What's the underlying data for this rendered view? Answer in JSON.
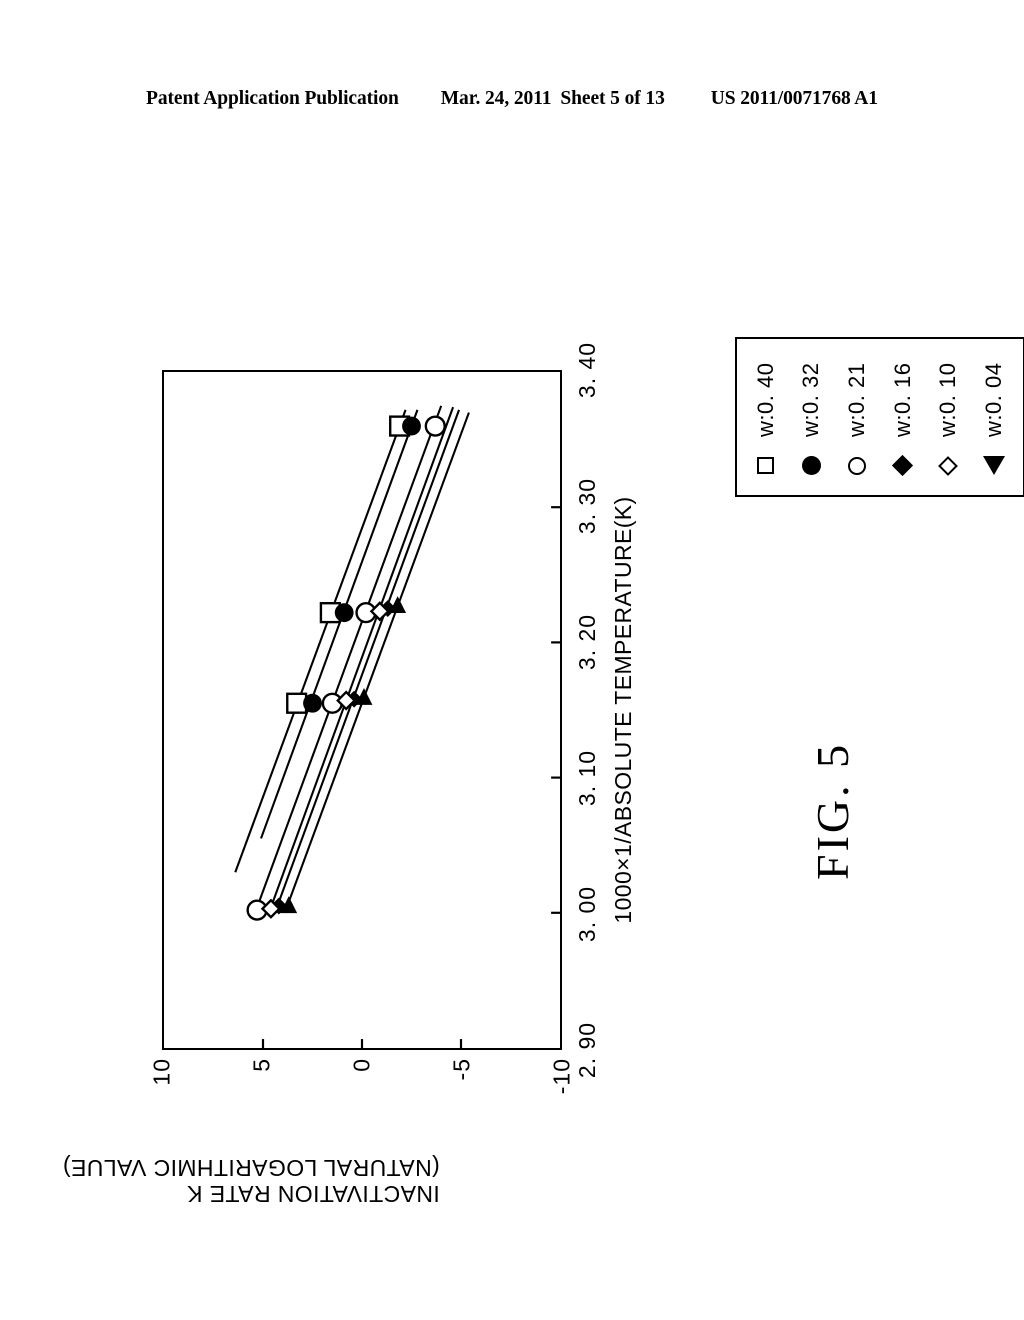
{
  "header": {
    "left": "Patent Application Publication",
    "date": "Mar. 24, 2011",
    "sheet": "Sheet 5 of 13",
    "patent_number": "US 2011/0071768 A1"
  },
  "figure": {
    "title": "FIG. 5"
  },
  "legend": {
    "items": [
      {
        "label": "w:0. 40",
        "marker": "square-open"
      },
      {
        "label": "w:0. 32",
        "marker": "circle-fill"
      },
      {
        "label": "w:0. 21",
        "marker": "circle-open"
      },
      {
        "label": "w:0. 16",
        "marker": "diamond-fill"
      },
      {
        "label": "w:0. 10",
        "marker": "diamond-open"
      },
      {
        "label": "w:0. 04",
        "marker": "triangle-fill"
      }
    ]
  },
  "chart_data": {
    "type": "scatter",
    "title": "FIG. 5",
    "xlabel": "1000×1/ABSOLUTE TEMPERATURE(K)",
    "ylabel": "INACTIVATION RATE K (NATURAL LOGARITHMIC VALUE)",
    "ylabel_lines": [
      "INACTIVATION RATE K",
      "(NATURAL LOGARITHMIC VALUE)"
    ],
    "xlim": [
      2.9,
      3.4
    ],
    "ylim": [
      -10,
      10
    ],
    "xticks": [
      "2. 90",
      "3. 00",
      "3. 10",
      "3. 20",
      "3. 30",
      "3. 40"
    ],
    "xtick_values": [
      2.9,
      3.0,
      3.1,
      3.2,
      3.3,
      3.4
    ],
    "yticks": [
      "10",
      "5",
      "0",
      "-5",
      "-10"
    ],
    "ytick_values": [
      10,
      5,
      0,
      -5,
      -10
    ],
    "grid": false,
    "legend_position": "outside-top-right",
    "series": [
      {
        "name": "w:0. 40",
        "marker": "square-open",
        "points": [
          {
            "x": 3.155,
            "y": 3.3
          },
          {
            "x": 3.222,
            "y": 1.6
          },
          {
            "x": 3.36,
            "y": -1.9
          }
        ],
        "fit_line": {
          "x0": 3.03,
          "y0": 6.4,
          "x1": 3.372,
          "y1": -2.2
        }
      },
      {
        "name": "w:0. 32",
        "marker": "circle-fill",
        "points": [
          {
            "x": 3.155,
            "y": 2.5
          },
          {
            "x": 3.222,
            "y": 0.9
          },
          {
            "x": 3.36,
            "y": -2.5
          }
        ],
        "fit_line": {
          "x0": 3.055,
          "y0": 5.1,
          "x1": 3.372,
          "y1": -2.8
        }
      },
      {
        "name": "w:0. 21",
        "marker": "circle-open",
        "points": [
          {
            "x": 3.002,
            "y": 5.3
          },
          {
            "x": 3.155,
            "y": 1.5
          },
          {
            "x": 3.222,
            "y": -0.2
          },
          {
            "x": 3.36,
            "y": -3.7
          }
        ],
        "fit_line": {
          "x0": 3.0,
          "y0": 5.4,
          "x1": 3.375,
          "y1": -4.0
        }
      },
      {
        "name": "w:0. 16",
        "marker": "diamond-fill",
        "points": [
          {
            "x": 3.005,
            "y": 4.2
          },
          {
            "x": 3.158,
            "y": 0.4
          },
          {
            "x": 3.225,
            "y": -1.3
          }
        ],
        "fit_line": {
          "x0": 3.0,
          "y0": 4.4,
          "x1": 3.372,
          "y1": -4.9
        }
      },
      {
        "name": "w:0. 10",
        "marker": "diamond-open",
        "points": [
          {
            "x": 3.003,
            "y": 4.6
          },
          {
            "x": 3.157,
            "y": 0.8
          },
          {
            "x": 3.223,
            "y": -0.9
          }
        ],
        "fit_line": {
          "x0": 3.0,
          "y0": 4.7,
          "x1": 3.374,
          "y1": -4.6
        }
      },
      {
        "name": "w:0. 04",
        "marker": "triangle-fill",
        "points": [
          {
            "x": 3.006,
            "y": 3.7
          },
          {
            "x": 3.16,
            "y": -0.1
          },
          {
            "x": 3.228,
            "y": -1.8
          }
        ],
        "fit_line": {
          "x0": 3.0,
          "y0": 3.9,
          "x1": 3.37,
          "y1": -5.4
        }
      }
    ]
  }
}
